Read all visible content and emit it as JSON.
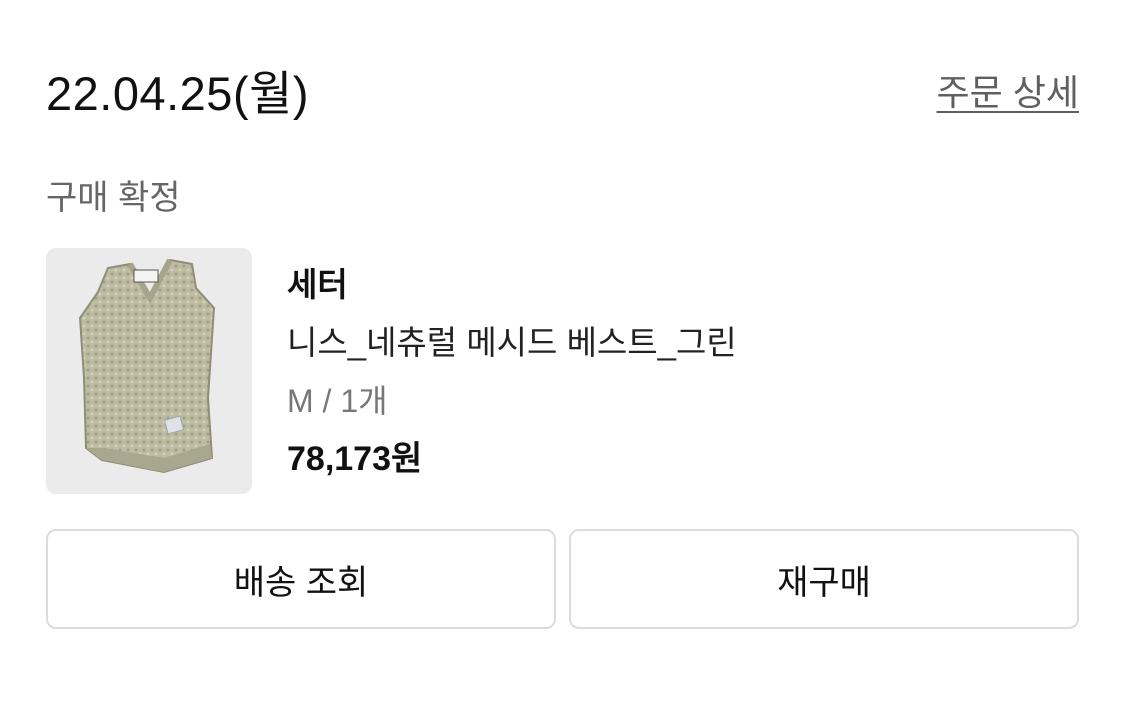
{
  "order": {
    "date": "22.04.25(월)",
    "detail_link": "주문 상세",
    "status": "구매 확정"
  },
  "product": {
    "image_icon": "knit-vest-product-image",
    "brand": "세터",
    "name": "니스_네츄럴 메시드 베스트_그린",
    "option": "M / 1개",
    "price": "78,173원",
    "colors": {
      "knit": "#b9b79c",
      "thumb_bg": "#ebebeb"
    }
  },
  "actions": {
    "track_label": "배송 조회",
    "rebuy_label": "재구매"
  }
}
